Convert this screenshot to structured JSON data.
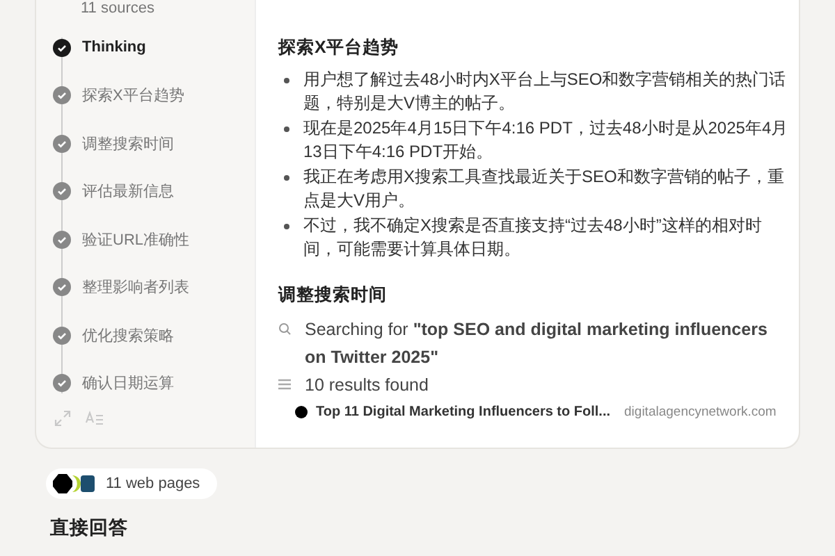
{
  "sources_label": "11 sources",
  "steps": [
    {
      "label": "Thinking",
      "active": true
    },
    {
      "label": "探索X平台趋势",
      "active": false
    },
    {
      "label": "调整搜索时间",
      "active": false
    },
    {
      "label": "评估最新信息",
      "active": false
    },
    {
      "label": "验证URL准确性",
      "active": false
    },
    {
      "label": "整理影响者列表",
      "active": false
    },
    {
      "label": "优化搜索策略",
      "active": false
    },
    {
      "label": "确认日期运算",
      "active": false
    }
  ],
  "sections": [
    {
      "heading": "探索X平台趋势",
      "bullets": [
        "用户想了解过去48小时内X平台上与SEO和数字营销相关的热门话题，特别是大V博主的帖子。",
        "现在是2025年4月15日下午4:16 PDT，过去48小时是从2025年4月13日下午4:16 PDT开始。",
        "我正在考虑用X搜索工具查找最近关于SEO和数字营销的帖子，重点是大V用户。",
        "不过，我不确定X搜索是否直接支持“过去48小时”这样的相对时间，可能需要计算具体日期。"
      ]
    },
    {
      "heading": "调整搜索时间",
      "search": "Searching for **\"top SEO and digital marketing influencers on Twitter 2025\"**",
      "results_count": "10 results found",
      "results": [
        {
          "title": "Top 11 Digital Marketing Influencers to Foll...",
          "domain": "digitalagencynetwork.com"
        }
      ]
    }
  ],
  "web_pages_label": "11 web pages",
  "answer_heading": "直接回答"
}
